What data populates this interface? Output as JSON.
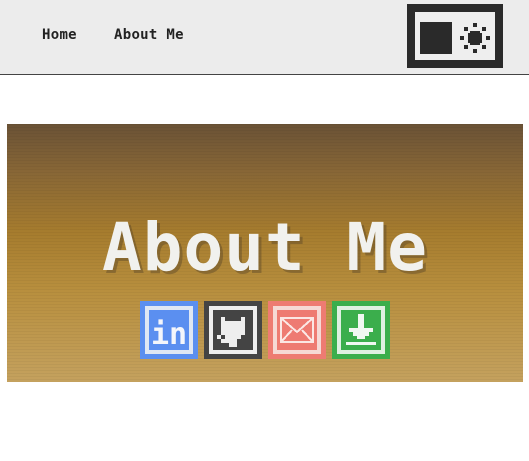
{
  "nav": {
    "items": [
      {
        "label": "Home"
      },
      {
        "label": "About Me"
      }
    ]
  },
  "theme_toggle": {
    "icons": [
      "dark-mode-square-icon",
      "sun-icon"
    ]
  },
  "banner": {
    "title": "About Me",
    "social_links": [
      {
        "name": "linkedin",
        "icon": "linkedin-icon",
        "color": "#5b8ff0",
        "text": "in"
      },
      {
        "name": "github",
        "icon": "github-icon",
        "color": "#444444"
      },
      {
        "name": "email",
        "icon": "mail-icon",
        "color": "#ee7b72"
      },
      {
        "name": "download",
        "icon": "download-icon",
        "color": "#3bae4c"
      }
    ]
  },
  "colors": {
    "nav_bg": "#ececec",
    "banner_top": "#6a5236",
    "banner_mid": "#a67c2e",
    "banner_bottom": "#c4a15e",
    "title_text": "#f1f1ee"
  }
}
